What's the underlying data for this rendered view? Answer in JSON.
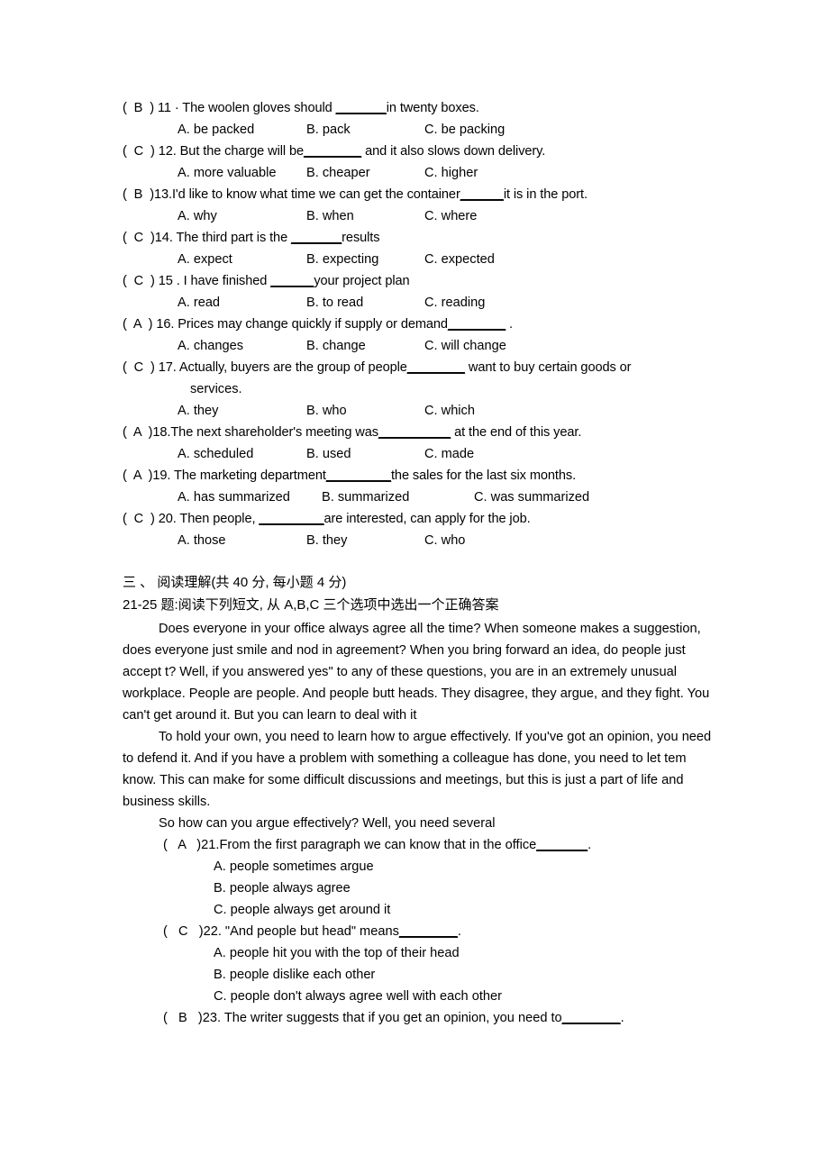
{
  "document": {
    "grammar_questions": [
      {
        "mark": "(  B  ) ",
        "stem_before": "11 · The woolen gloves should  ",
        "blank": "_______",
        "stem_after": "in twenty boxes.",
        "options": [
          "A. be packed",
          "B. pack",
          "C. be packing"
        ]
      },
      {
        "mark": "(  C  ) ",
        "stem_before": "12. But the charge will be",
        "blank": "________",
        "stem_after": " and it also slows down delivery.",
        "options": [
          "A. more valuable",
          "B. cheaper",
          "C. higher"
        ]
      },
      {
        "mark": "(  B  )",
        "stem_before": "13.I'd like to know what time we can get the container",
        "blank": "______",
        "stem_after": "it is in the port.",
        "options": [
          "A. why",
          "B. when",
          "C. where"
        ]
      },
      {
        "mark": "(  C  )",
        "stem_before": "14. The third part is the  ",
        "blank": "_______",
        "stem_after": "results",
        "options": [
          "A. expect",
          "B. expecting",
          "C. expected"
        ]
      },
      {
        "mark": "(  C  ) ",
        "stem_before": "15 . I have finished  ",
        "blank": "______",
        "stem_after": "your project plan",
        "options": [
          "A. read",
          "B. to read",
          "C. reading"
        ]
      },
      {
        "mark": "(  A  ) ",
        "stem_before": "16. Prices may change quickly if supply or demand",
        "blank": "________",
        "stem_after": " .",
        "options": [
          "A. changes",
          "B. change",
          "C. will change"
        ]
      },
      {
        "mark": "(  C  ) ",
        "stem_before": "17. Actually, buyers are the group of people",
        "blank": "________",
        "stem_after": " want to buy certain goods or",
        "continuation": "services.",
        "options": [
          "A. they",
          "B. who",
          "C. which"
        ]
      },
      {
        "mark": "(  A  )",
        "stem_before": "18.The next shareholder's meeting was",
        "blank": "__________",
        "stem_after": " at the end of this year.",
        "options": [
          "A. scheduled",
          "B. used",
          "C. made"
        ]
      },
      {
        "mark": "(  A  )",
        "stem_before": "19. The marketing department",
        "blank": "_________",
        "stem_after": "the sales for the last six months.",
        "options": [
          "A. has summarized",
          "B. summarized",
          "C. was summarized"
        ],
        "wide": true
      },
      {
        "mark": "(  C  ) ",
        "stem_before": "20. Then people,  ",
        "blank": "_________",
        "stem_after": "are interested, can apply for the job.",
        "options": [
          "A. those",
          "B. they",
          "C. who"
        ]
      }
    ],
    "section_heading": "三 、  阅读理解(共 40 分, 每小题 4  分)",
    "section_subheading": "21-25 题:阅读下列短文, 从  A,B,C  三个选项中选出一个正确答案",
    "passage": [
      "Does everyone in your office always agree all the time? When someone makes a suggestion, does everyone just smile and nod in agreement? When you bring forward an idea, do people just accept t? Well, if you answered yes\" to any of these questions, you are in an extremely unusual workplace. People are people. And people butt heads. They disagree, they argue, and they fight. You can't get around it. But you can learn to deal with it",
      "To hold your own, you need to learn how to argue effectively. If you've got an opinion, you need to defend it. And if you have a problem with something a colleague has done, you need to let tem know. This can make for some difficult discussions and meetings, but this is just a part of life and business skills.",
      "So how can you argue effectively? Well, you need several"
    ],
    "reading_questions": [
      {
        "mark": "(   A   )",
        "stem_before": "21.From the first paragraph we can know that in the office",
        "blank": "_______",
        "stem_after": ".",
        "options": [
          "A. people sometimes argue",
          "B. people always agree",
          "C. people always get around it"
        ]
      },
      {
        "mark": "(   C   )",
        "stem_before": "22. \"And people but head\" means",
        "blank": "________",
        "stem_after": ".",
        "options": [
          "A. people hit you with the top of their head",
          "B. people dislike each other",
          "C. people don't always agree well with each other"
        ]
      },
      {
        "mark": "(   B   )",
        "stem_before": "23. The writer suggests that if you get an opinion, you need to",
        "blank": "________",
        "stem_after": ".",
        "options": []
      }
    ]
  }
}
